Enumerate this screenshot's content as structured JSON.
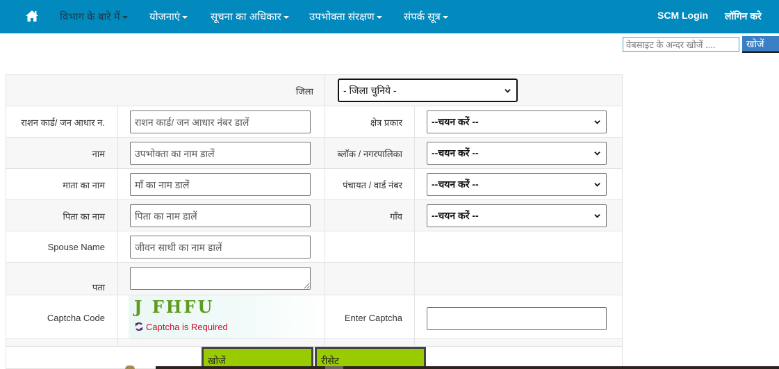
{
  "navbar": {
    "home_icon": "home-icon",
    "items": [
      {
        "label": "विभाग के बारे में",
        "has_dropdown": true
      },
      {
        "label": "योजनाएं",
        "has_dropdown": true
      },
      {
        "label": "सूचना का अधिकार",
        "has_dropdown": true
      },
      {
        "label": "उपभोक्ता संरक्षण",
        "has_dropdown": true
      },
      {
        "label": "संपर्क सूत्र",
        "has_dropdown": true
      }
    ],
    "right_links": [
      "SCM Login",
      "लॉगिन करे"
    ],
    "background_color": "#0289bd"
  },
  "site_search": {
    "placeholder": "वेबसाइट के अन्दर खोजें ....",
    "value": "",
    "button_label": "खोजें"
  },
  "form": {
    "district": {
      "label": "जिला",
      "selected": "- जिला चुनिये -"
    },
    "ration_card": {
      "label": "राशन कार्ड/ जन आधार न.",
      "placeholder": "राशन कार्ड/ जन आधार नंबर डालें",
      "value": ""
    },
    "area_type": {
      "label": "क्षेत्र प्रकार",
      "selected": "--चयन करें --"
    },
    "name": {
      "label": "नाम",
      "placeholder": "उपभोक्ता का नाम डालें",
      "value": ""
    },
    "block": {
      "label": "ब्लॉक / नगरपालिका",
      "selected": "--चयन करें --"
    },
    "mother_name": {
      "label": "माता का नाम",
      "placeholder": "माँ का नाम डालें",
      "value": ""
    },
    "panchayat": {
      "label": "पंचायत / वार्ड नंबर",
      "selected": "--चयन करें --"
    },
    "father_name": {
      "label": "पिता का नाम",
      "placeholder": "पिता का नाम डालें",
      "value": ""
    },
    "village": {
      "label": "गाँव",
      "selected": "--चयन करें --"
    },
    "spouse_name": {
      "label": "Spouse Name",
      "placeholder": "जीवन साथी का नाम डालें",
      "value": ""
    },
    "address": {
      "label": "पता",
      "value": ""
    },
    "captcha": {
      "label": "Captcha Code",
      "image_text": "J FHFU",
      "error": "Captcha is Required",
      "enter_label": "Enter Captcha",
      "enter_value": ""
    },
    "buttons": {
      "search": "खोजें",
      "reset": "रीसेट"
    },
    "button_color": "#99cc00"
  }
}
